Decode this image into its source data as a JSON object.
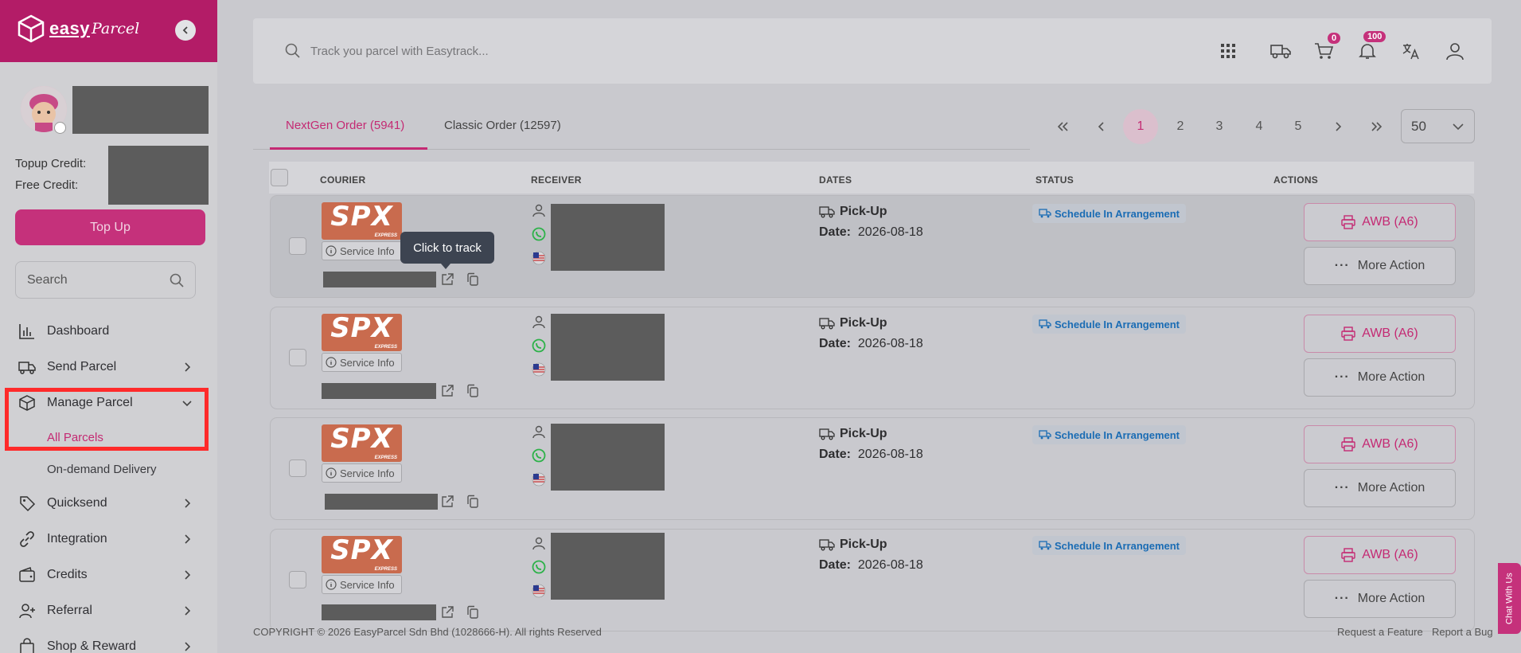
{
  "brand": {
    "name": "easy",
    "name_italic": "Parcel"
  },
  "sidebar": {
    "topup_label": "Topup Credit:",
    "free_label": "Free Credit:",
    "topup_button": "Top Up",
    "search_placeholder": "Search",
    "nav": [
      {
        "label": "Dashboard",
        "icon": "chart-bar-icon"
      },
      {
        "label": "Send Parcel",
        "icon": "truck-icon"
      },
      {
        "label": "Manage Parcel",
        "icon": "box-icon"
      },
      {
        "label": "All Parcels"
      },
      {
        "label": "On-demand Delivery"
      },
      {
        "label": "Quicksend",
        "icon": "tag-icon"
      },
      {
        "label": "Integration",
        "icon": "link-icon"
      },
      {
        "label": "Credits",
        "icon": "wallet-icon"
      },
      {
        "label": "Referral",
        "icon": "user-plus-icon"
      },
      {
        "label": "Shop & Reward",
        "icon": "bag-icon"
      }
    ]
  },
  "topbar": {
    "search_placeholder": "Track you parcel with Easytrack...",
    "cart_count": "0",
    "notif_count": "100"
  },
  "tabs": [
    {
      "label": "NextGen Order (5941)",
      "active": true
    },
    {
      "label": "Classic Order (12597)",
      "active": false
    }
  ],
  "pagination": {
    "pages": [
      "1",
      "2",
      "3",
      "4",
      "5"
    ],
    "current": "1",
    "per_page": "50"
  },
  "table": {
    "headers": [
      "COURIER",
      "RECEIVER",
      "DATES",
      "STATUS",
      "ACTIONS"
    ],
    "rows": [
      {
        "courier": "SPX",
        "courier_sub": "EXPRESS",
        "service_info": "Service Info",
        "date_type": "Pick-Up",
        "date_label": "Date:",
        "date": "2026-08-18",
        "status": "Schedule In Arrangement",
        "awb": "AWB (A6)",
        "more": "More Action"
      },
      {
        "courier": "SPX",
        "courier_sub": "EXPRESS",
        "service_info": "Service Info",
        "date_type": "Pick-Up",
        "date_label": "Date:",
        "date": "2026-08-18",
        "status": "Schedule In Arrangement",
        "awb": "AWB (A6)",
        "more": "More Action"
      },
      {
        "courier": "SPX",
        "courier_sub": "EXPRESS",
        "service_info": "Service Info",
        "date_type": "Pick-Up",
        "date_label": "Date:",
        "date": "2026-08-18",
        "status": "Schedule In Arrangement",
        "awb": "AWB (A6)",
        "more": "More Action"
      },
      {
        "courier": "SPX",
        "courier_sub": "EXPRESS",
        "service_info": "Service Info",
        "date_type": "Pick-Up",
        "date_label": "Date:",
        "date": "2026-08-18",
        "status": "Schedule In Arrangement",
        "awb": "AWB (A6)",
        "more": "More Action"
      }
    ]
  },
  "tooltip": "Click to track",
  "footer": {
    "copyright": "COPYRIGHT © 2026 EasyParcel Sdn Bhd (1028666-H). All rights Reserved",
    "request_feature": "Request a Feature",
    "report_bug": "Report a Bug"
  },
  "chat": "Chat With Us",
  "colors": {
    "brand": "#b31c67",
    "accent": "#c42a73",
    "status": "#1a6cb4"
  }
}
